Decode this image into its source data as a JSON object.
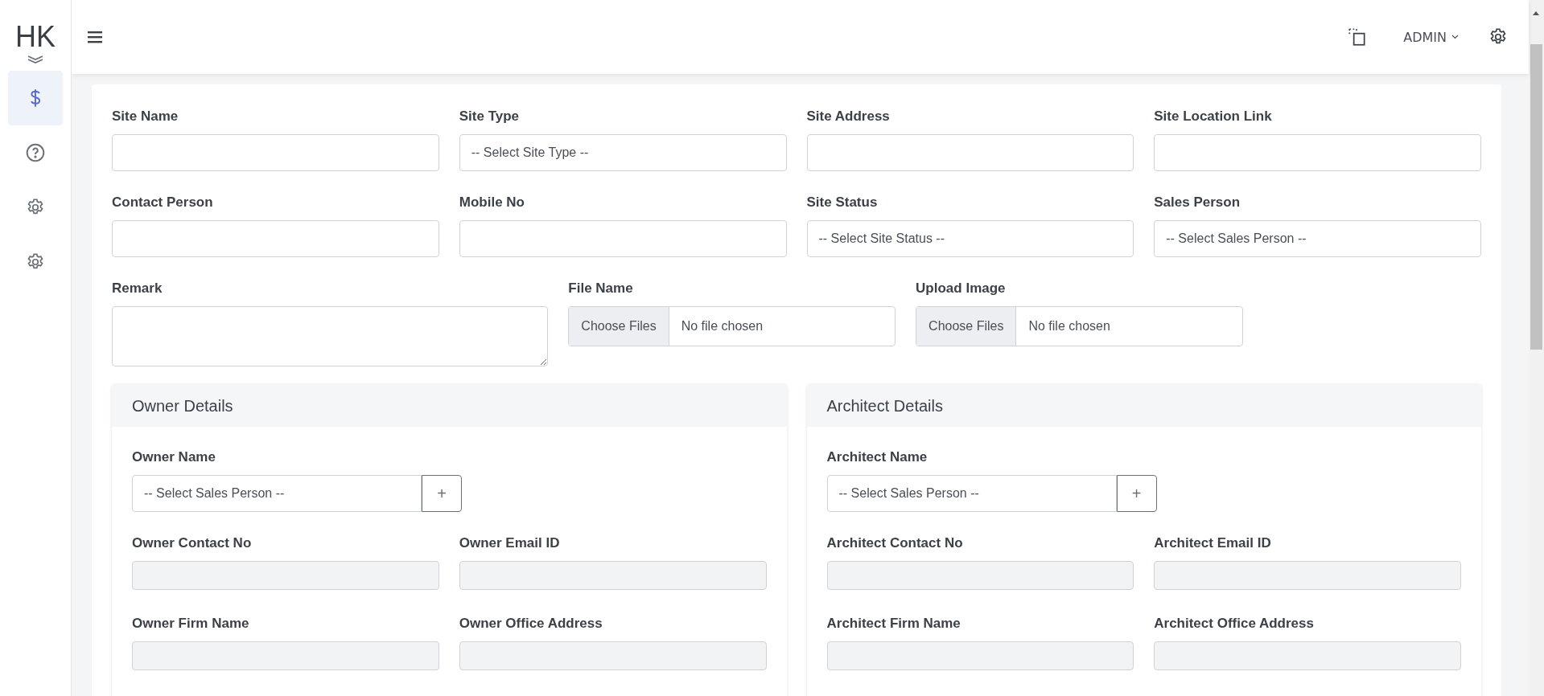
{
  "header": {
    "logo": "HK",
    "user_menu": "ADMIN"
  },
  "sidebar": {
    "items": [
      {
        "kind": "dollar",
        "selected": true
      },
      {
        "kind": "help",
        "selected": false
      },
      {
        "kind": "settings",
        "selected": false
      },
      {
        "kind": "settings",
        "selected": false
      }
    ]
  },
  "form": {
    "fields": [
      {
        "label": "Site Name",
        "kind": "text"
      },
      {
        "label": "Site Type",
        "kind": "select",
        "value": "-- Select Site Type --"
      },
      {
        "label": "Site Address",
        "kind": "text"
      },
      {
        "label": "Site Location Link",
        "kind": "text"
      },
      {
        "label": "Contact Person",
        "kind": "text"
      },
      {
        "label": "Mobile No",
        "kind": "text"
      },
      {
        "label": "Site Status",
        "kind": "select",
        "value": "-- Select Site Status --"
      },
      {
        "label": "Sales Person",
        "kind": "select",
        "value": "-- Select Sales Person --"
      }
    ],
    "extra_fields": [
      {
        "label": "Remark",
        "kind": "textarea"
      },
      {
        "label": "File Name",
        "kind": "file",
        "button": "Choose Files",
        "status": "No file chosen"
      },
      {
        "label": "Upload Image",
        "kind": "file",
        "button": "Choose Files",
        "status": "No file chosen"
      }
    ]
  },
  "panels": [
    {
      "title": "Owner Details",
      "picker": {
        "label": "Owner Name",
        "value": "-- Select Sales Person --",
        "add_button": "+"
      },
      "fields": [
        {
          "label": "Owner Contact No",
          "disabled": true
        },
        {
          "label": "Owner Email ID",
          "disabled": true
        },
        {
          "label": "Owner Firm Name",
          "disabled": true
        },
        {
          "label": "Owner Office Address",
          "disabled": true
        }
      ]
    },
    {
      "title": "Architect Details",
      "picker": {
        "label": "Architect Name",
        "value": "-- Select Sales Person --",
        "add_button": "+"
      },
      "fields": [
        {
          "label": "Architect Contact No",
          "disabled": true
        },
        {
          "label": "Architect Email ID",
          "disabled": true
        },
        {
          "label": "Architect Firm Name",
          "disabled": true
        },
        {
          "label": "Architect Office Address",
          "disabled": true
        }
      ]
    }
  ]
}
